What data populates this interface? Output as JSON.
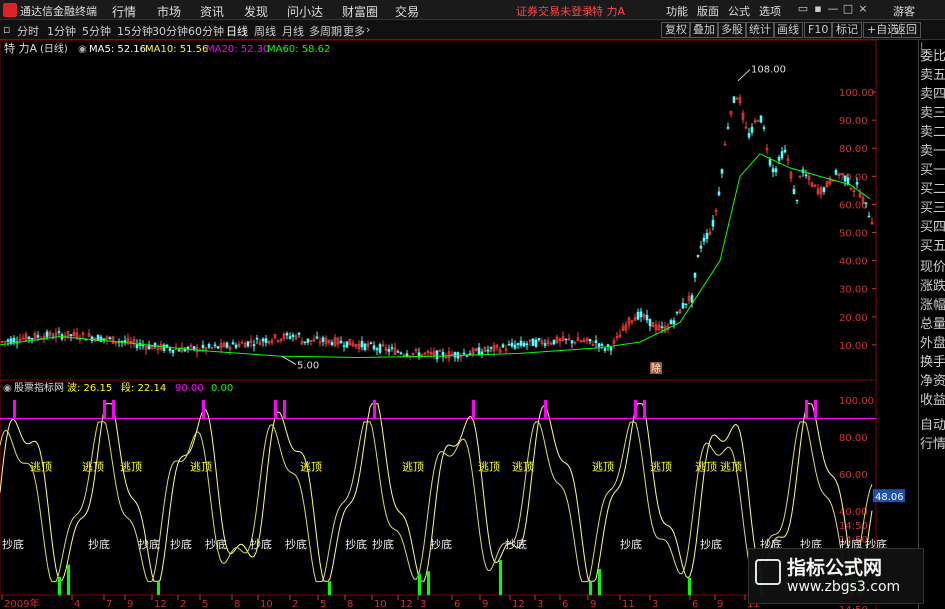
{
  "app": {
    "title": "通达信金融终端"
  },
  "menu": [
    "行情",
    "市场",
    "资讯",
    "发现",
    "问小达",
    "财富圈",
    "交易"
  ],
  "status": {
    "broker": "证券交易未登录",
    "stock": "特 力A"
  },
  "right_menu": [
    "功能",
    "版面",
    "公式",
    "选项"
  ],
  "user": "游客",
  "periods": [
    "分时",
    "1分钟",
    "5分钟",
    "15分钟",
    "30分钟",
    "60分钟",
    "日线",
    "周线",
    "月线",
    "多周期",
    "更多"
  ],
  "active_period": "日线",
  "tools": [
    "复权",
    "叠加",
    "多股",
    "统计",
    "画线",
    "F10",
    "标记",
    "+自选",
    "返回"
  ],
  "main_header": {
    "stock": "特 力A",
    "period": "(日线)",
    "ma": [
      {
        "label": "MA5:",
        "value": "52.16",
        "color": "#ffffff"
      },
      {
        "label": "MA10:",
        "value": "51.56",
        "color": "#ffff00"
      },
      {
        "label": "MA20:",
        "value": "52.30",
        "color": "#ff00ff"
      },
      {
        "label": "MA60:",
        "value": "58.62",
        "color": "#00ff00"
      }
    ]
  },
  "price_axis": [
    "100.00",
    "90.00",
    "80.00",
    "70.00",
    "60.00",
    "50.00",
    "40.00",
    "30.00",
    "20.00",
    "10.00"
  ],
  "annotations": {
    "high": "108.00",
    "low": "5.00",
    "event": "除"
  },
  "indicator_header": {
    "name": "股票指标网",
    "items": [
      {
        "label": "波:",
        "value": "26.15",
        "color": "#ffff00"
      },
      {
        "label": "段:",
        "value": "22.14",
        "color": "#ffff00"
      },
      {
        "label": "",
        "value": "90.00",
        "color": "#ff00ff"
      },
      {
        "label": "",
        "value": "0.00",
        "color": "#00ff00"
      }
    ]
  },
  "ind_axis": [
    "100.00",
    "80.00",
    "60.00",
    "40.00",
    "14:50",
    "14:50",
    "14:50",
    "14:50",
    "14:50",
    "14:50",
    "14:50"
  ],
  "ind_current": "48.06",
  "signals": {
    "top": "逃顶",
    "bottom": "抄底"
  },
  "date_axis": [
    "2009年",
    "4",
    "7",
    "9",
    "12",
    "2",
    "5",
    "8",
    "10",
    "2",
    "5",
    "8",
    "10",
    "12",
    "3",
    "6",
    "9",
    "12",
    "3",
    "6",
    "9",
    "11",
    "3",
    "6",
    "9",
    "11"
  ],
  "side_labels": [
    "L",
    "委比",
    "卖五",
    "卖四",
    "卖三",
    "卖二",
    "卖一",
    "买一",
    "买二",
    "买三",
    "买四",
    "买五",
    "现价",
    "涨跌",
    "涨幅",
    "总量",
    "外盘",
    "换手",
    "净资",
    "收益",
    "自动",
    "行情"
  ],
  "watermark": {
    "line1": "指标公式网",
    "line2": "www.zbgs3.com"
  },
  "chart_data": {
    "type": "line",
    "ylim": [
      0,
      112
    ],
    "series": [
      {
        "name": "MA60",
        "color": "#00ff00",
        "values": [
          [
            0,
            10
          ],
          [
            60,
            13
          ],
          [
            120,
            11
          ],
          [
            200,
            8
          ],
          [
            280,
            6
          ],
          [
            360,
            5.5
          ],
          [
            440,
            6
          ],
          [
            520,
            7
          ],
          [
            600,
            9
          ],
          [
            640,
            11
          ],
          [
            680,
            18
          ],
          [
            720,
            40
          ],
          [
            740,
            70
          ],
          [
            760,
            78
          ],
          [
            790,
            73
          ],
          [
            820,
            70
          ],
          [
            850,
            67
          ],
          [
            870,
            62
          ]
        ]
      },
      {
        "name": "波",
        "color": "#ffff00"
      },
      {
        "name": "段",
        "color": "#ffff00"
      }
    ]
  }
}
